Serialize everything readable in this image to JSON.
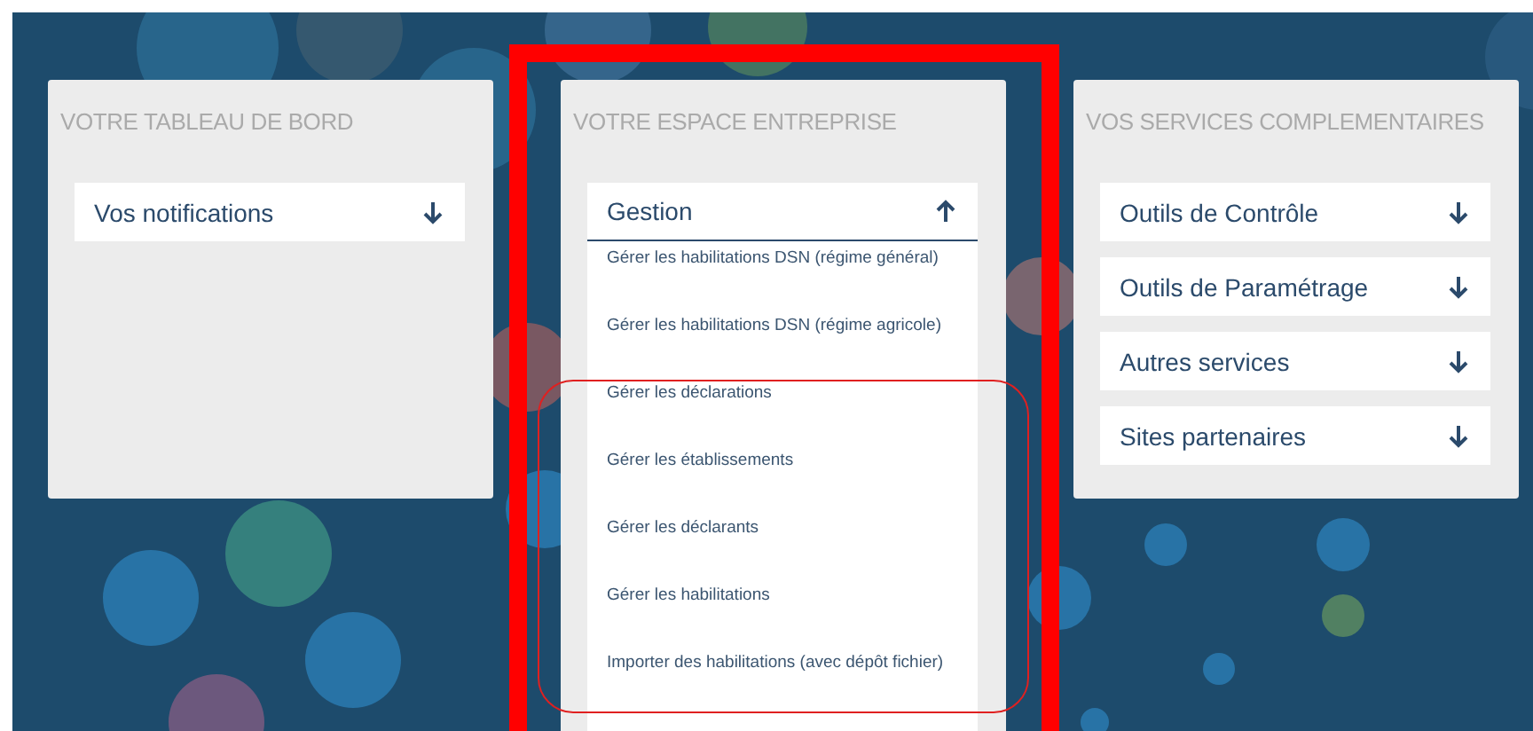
{
  "panels": [
    {
      "title": "VOTRE TABLEAU DE BORD",
      "items": [
        {
          "label": "Vos notifications",
          "expanded": false
        }
      ]
    },
    {
      "title": "VOTRE ESPACE ENTREPRISE",
      "items": [
        {
          "label": "Gestion",
          "expanded": true,
          "children": [
            {
              "label": "Gérer les habilitations DSN (régime général)"
            },
            {
              "label": "Gérer les habilitations DSN (régime agricole)"
            },
            {
              "label": "Gérer les déclarations"
            },
            {
              "label": "Gérer les établissements"
            },
            {
              "label": "Gérer les déclarants"
            },
            {
              "label": "Gérer les habilitations"
            },
            {
              "label": "Importer des habilitations (avec dépôt fichier)"
            }
          ]
        }
      ]
    },
    {
      "title": "VOS SERVICES COMPLEMENTAIRES",
      "items": [
        {
          "label": "Outils de Contrôle",
          "expanded": false
        },
        {
          "label": "Outils de Paramétrage",
          "expanded": false
        },
        {
          "label": "Autres services",
          "expanded": false
        },
        {
          "label": "Sites partenaires",
          "expanded": false
        }
      ]
    }
  ]
}
